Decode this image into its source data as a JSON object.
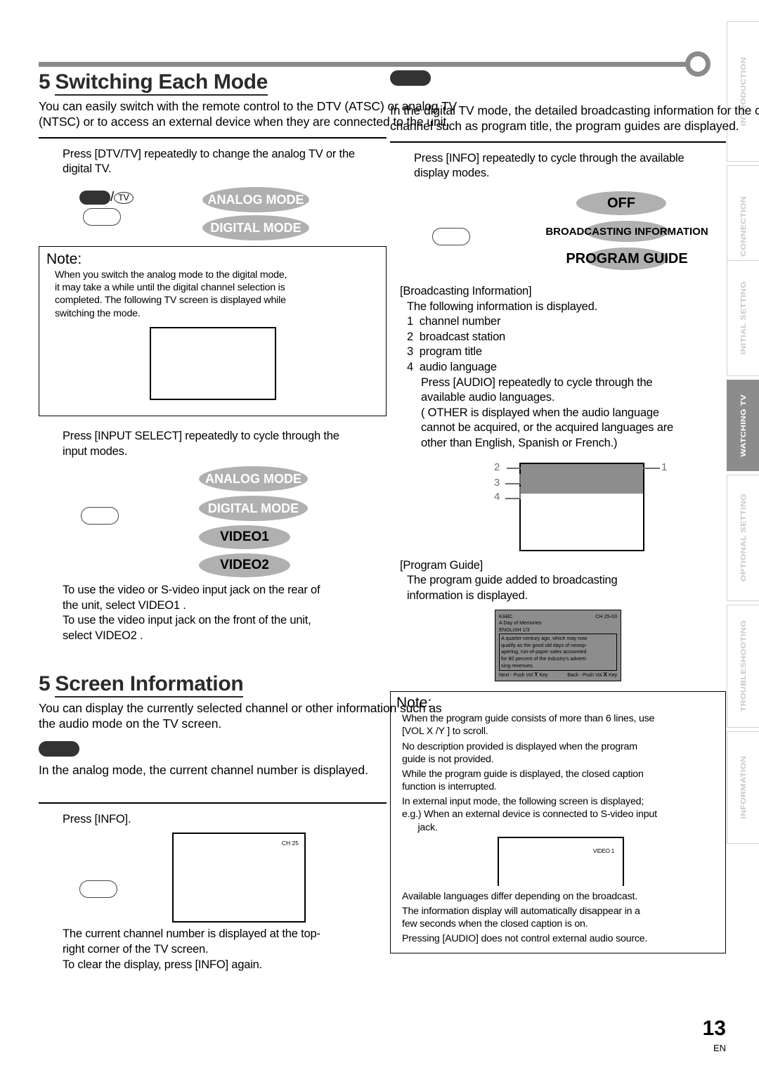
{
  "page": {
    "number": "13",
    "lang": "EN"
  },
  "sidebar": {
    "items": [
      {
        "label": "INTRODUCTION",
        "active": false
      },
      {
        "label": "CONNECTION",
        "active": false
      },
      {
        "label": "INITIAL SETTING",
        "active": false
      },
      {
        "label": "WATCHING TV",
        "active": true
      },
      {
        "label": "OPTIONAL SETTING",
        "active": false
      },
      {
        "label": "TROUBLESHOOTING",
        "active": false
      },
      {
        "label": "INFORMATION",
        "active": false
      }
    ]
  },
  "left": {
    "section1": {
      "number": "5",
      "title": "Switching Each Mode",
      "intro_line1": "You can easily switch with the remote control to the DTV (ATSC) or analog TV",
      "intro_line2": "(NTSC) or to access an external device when they are connected to the unit.",
      "step1": "Press [DTV/TV] repeatedly to change the analog TV or the digital TV.",
      "mode_ellipses": [
        {
          "label": "ANALOG MODE"
        },
        {
          "label": "DIGITAL MODE"
        }
      ],
      "button_tv_tag": "TV",
      "note": {
        "title": "Note:",
        "lines": [
          "When you switch the analog mode to the digital mode,",
          "it may take a while until the digital channel selection is",
          "completed. The following TV screen is displayed while",
          "switching the mode."
        ]
      },
      "step2": "Press [INPUT SELECT] repeatedly to cycle through the input modes.",
      "input_ellipses": [
        {
          "label": "ANALOG MODE"
        },
        {
          "label": "DIGITAL MODE"
        },
        {
          "label": "VIDEO1"
        },
        {
          "label": "VIDEO2"
        }
      ],
      "after_text_line1": "To use the video or S-video input jack on the rear of",
      "after_text_line2": "the unit, select  VIDEO1 .",
      "after_text_line3": "To use the video input jack on the front of the unit,",
      "after_text_line4": "select  VIDEO2 ."
    },
    "section2": {
      "number": "5",
      "title": "Screen Information",
      "intro_line1": "You can display the currently selected channel or other information such as",
      "intro_line2": "the audio mode on the TV screen.",
      "subhead_text": "In the analog mode, the current channel number is displayed.",
      "step1": "Press [INFO].",
      "tv_channel_label": "CH 25",
      "after_line1": "The current channel number is displayed at the top-",
      "after_line2": "right corner of the TV screen.",
      "after_line3": "To clear the display, press [INFO] again."
    }
  },
  "right": {
    "intro_line1": "In the digital TV mode, the detailed broadcasting information for the current",
    "intro_line2": "channel such as program title, the program guides are displayed.",
    "step1": "Press [INFO] repeatedly to cycle through the available display modes.",
    "mode_ellipses": [
      {
        "label": "OFF"
      },
      {
        "label": "BROADCASTING INFORMATION"
      },
      {
        "label": "PROGRAM GUIDE"
      }
    ],
    "broadcast": {
      "heading": "[Broadcasting Information]",
      "subheading": "The following information is displayed.",
      "items": [
        {
          "num": "1",
          "text": "channel number"
        },
        {
          "num": "2",
          "text": "broadcast station"
        },
        {
          "num": "3",
          "text": "program title"
        },
        {
          "num": "4",
          "text": "audio language"
        }
      ],
      "note_lines": [
        "Press [AUDIO] repeatedly to cycle through the",
        "available audio languages.",
        "( OTHER  is displayed when the audio language",
        "cannot be acquired, or the acquired languages are",
        "other than English, Spanish or French.)"
      ],
      "callouts": [
        "1",
        "2",
        "3",
        "4"
      ]
    },
    "program_guide": {
      "heading": "[Program Guide]",
      "line1": "The program guide added to broadcasting",
      "line2": "information is displayed.",
      "mock": {
        "station": "KABC",
        "channel": "CH 25-03",
        "title": "A Day of Memories",
        "language": "ENGLISH  1/3",
        "description": [
          "A quarter-century ago, which may now",
          "qualify as the good old days of newsp-",
          "apering, run-of-paper sales accounted",
          "for 80 percent of the industry's adverti-",
          "sing revenues."
        ],
        "footer_next": "Next - Push Vol",
        "footer_next_key": "Y",
        "footer_next_suffix": "Key",
        "footer_back": "Back - Push Vol",
        "footer_back_key": "X",
        "footer_back_suffix": "Key"
      }
    },
    "note": {
      "title": "Note:",
      "paragraphs": [
        [
          "When the program guide consists of more than 6 lines, use",
          "[VOL X /Y ] to scroll."
        ],
        [
          " No description provided   is displayed when the program",
          "guide is not provided."
        ],
        [
          "While the program guide is displayed, the closed caption",
          "function is interrupted."
        ],
        [
          "In external input mode, the following screen is displayed;",
          "e.g.) When an external device is connected to S-video input",
          "      jack."
        ]
      ],
      "video_label": "VIDEO 1",
      "tail_paragraphs": [
        [
          "Available languages differ depending on the broadcast."
        ],
        [
          "The information display will automatically disappear in a",
          "few seconds when the closed caption is on."
        ],
        [
          "Pressing [AUDIO] does not control external audio source."
        ]
      ]
    }
  },
  "colors": {
    "ellipse": "#b0b0b0",
    "active_tab": "#8c8c8c",
    "header_gray": "#8a8a8a",
    "screen_gray": "#8d8d8d"
  }
}
